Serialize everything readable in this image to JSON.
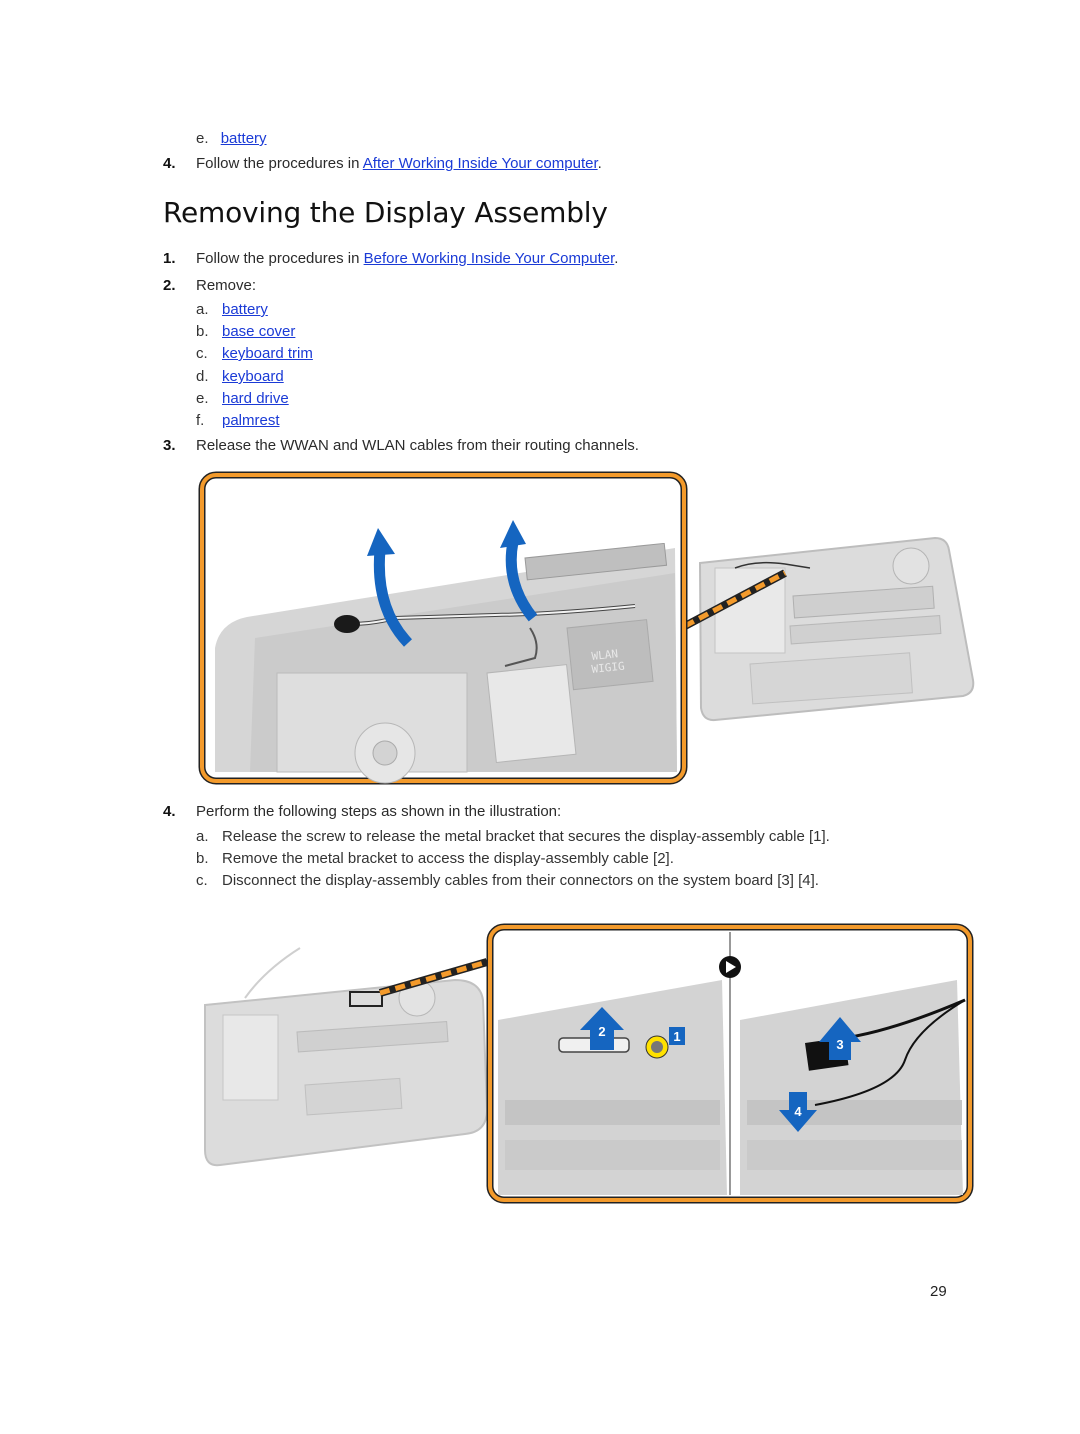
{
  "prev_section": {
    "sub_item": {
      "letter": "e.",
      "link": "battery"
    },
    "step4": {
      "num": "4.",
      "text": "Follow the procedures in ",
      "link": "After Working Inside Your computer",
      "suffix": "."
    }
  },
  "section": {
    "title": "Removing the Display Assembly",
    "steps": [
      {
        "num": "1.",
        "text": "Follow the procedures in ",
        "link": "Before Working Inside Your Computer",
        "suffix": "."
      },
      {
        "num": "2.",
        "text": "Remove:",
        "items": [
          {
            "letter": "a.",
            "link": "battery"
          },
          {
            "letter": "b.",
            "link": "base cover"
          },
          {
            "letter": "c.",
            "link": "keyboard trim"
          },
          {
            "letter": "d.",
            "link": "keyboard"
          },
          {
            "letter": "e.",
            "link": "hard drive"
          },
          {
            "letter": "f.",
            "link": "palmrest"
          }
        ]
      },
      {
        "num": "3.",
        "text": "Release the WWAN and WLAN cables from their routing channels."
      },
      {
        "num": "4.",
        "text": "Perform the following steps as shown in the illustration:",
        "items": [
          {
            "letter": "a.",
            "text": "Release the screw to release the metal bracket that secures the display-assembly cable [1]."
          },
          {
            "letter": "b.",
            "text": "Remove the metal bracket to access the display-assembly cable [2]."
          },
          {
            "letter": "c.",
            "text": "Disconnect the display-assembly cables from their connectors on the system board [3] [4]."
          }
        ]
      }
    ]
  },
  "figure1": {
    "labels": [
      "WLAN",
      "WIGIG"
    ]
  },
  "figure2": {
    "callouts": [
      "1",
      "2",
      "3",
      "4"
    ]
  },
  "colors": {
    "link": "#1a3ad6",
    "frame": "#f39a2b",
    "arrow": "#1565c0"
  },
  "page_number": "29"
}
